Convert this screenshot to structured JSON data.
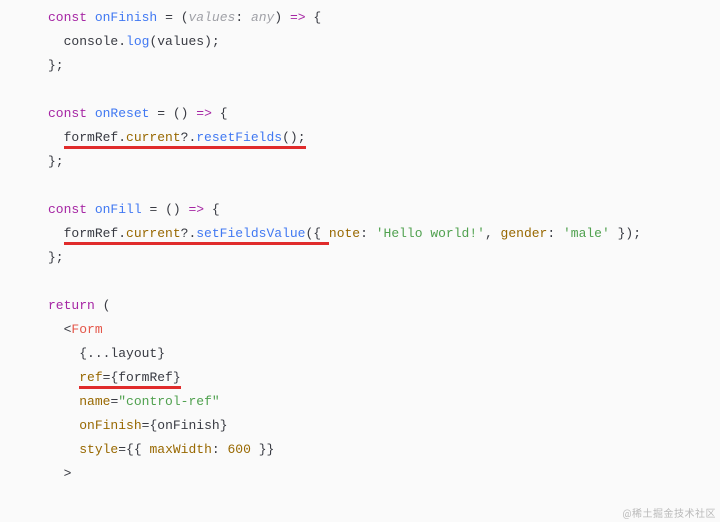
{
  "code": {
    "fn1": {
      "kw_const": "const",
      "name": "onFinish",
      "eq": "=",
      "paren_open": "(",
      "param": "values",
      "colon": ":",
      "type": "any",
      "paren_close": ")",
      "arrow": "=>",
      "brace_open": "{"
    },
    "fn1_body": {
      "obj": "console",
      "dot": ".",
      "method": "log",
      "po": "(",
      "arg": "values",
      "pc": ")",
      "semi": ";"
    },
    "fn_close": "};",
    "fn2": {
      "kw_const": "const",
      "name": "onReset",
      "eq": "=",
      "parens": "()",
      "arrow": "=>",
      "brace_open": "{"
    },
    "fn2_body": {
      "obj": "formRef",
      "dot1": ".",
      "prop": "current",
      "opt": "?.",
      "method": "resetFields",
      "parens": "()",
      "semi": ";"
    },
    "fn3": {
      "kw_const": "const",
      "name": "onFill",
      "eq": "=",
      "parens": "()",
      "arrow": "=>",
      "brace_open": "{"
    },
    "fn3_body": {
      "obj": "formRef",
      "dot1": ".",
      "prop": "current",
      "opt": "?.",
      "method": "setFieldsValue",
      "po": "(",
      "bo": "{ ",
      "k1": "note",
      "c1": ": ",
      "v1": "'Hello world!'",
      "comma": ", ",
      "k2": "gender",
      "c2": ": ",
      "v2": "'male'",
      "bc": " }",
      "pc": ")",
      "semi": ";"
    },
    "ret": {
      "kw": "return",
      "paren": "("
    },
    "jsx": {
      "lt": "<",
      "tag": "Form",
      "spread": "{...layout}",
      "refAttr": "ref",
      "refEq": "=",
      "refBo": "{",
      "refVal": "formRef",
      "refBc": "}",
      "nameAttr": "name",
      "nameEq": "=",
      "nameVal": "\"control-ref\"",
      "onFinishAttr": "onFinish",
      "ofEq": "=",
      "ofBo": "{",
      "ofVal": "onFinish",
      "ofBc": "}",
      "styleAttr": "style",
      "stEq": "=",
      "stBoOuter": "{",
      "stBoInner": "{ ",
      "stKey": "maxWidth",
      "stColon": ": ",
      "stVal": "600",
      "stBcInner": " }",
      "stBcOuter": "}",
      "gt": ">"
    }
  },
  "watermark": "@稀土掘金技术社区"
}
